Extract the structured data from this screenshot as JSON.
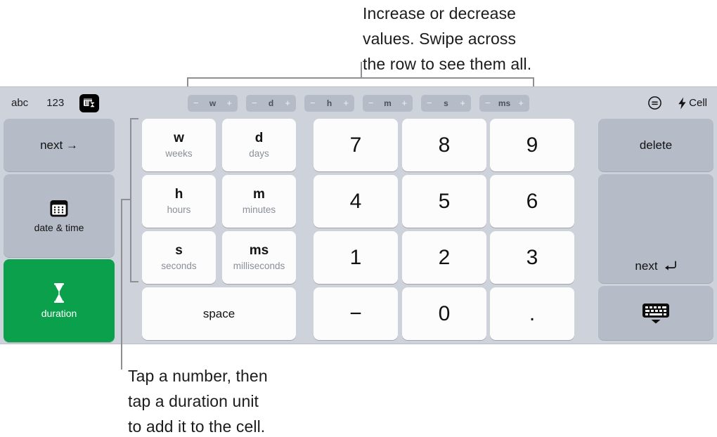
{
  "annotations": {
    "top_callout": "Increase or decrease\nvalues. Swipe across\nthe row to see them all.",
    "bottom_callout": "Tap a number, then\ntap a duration unit\nto add it to the cell."
  },
  "keyboard": {
    "toolbar": {
      "modes": [
        {
          "label": "abc",
          "name": "abc"
        },
        {
          "label": "123",
          "name": "123"
        }
      ],
      "mode_icon_name": "table-duration-icon",
      "steppers": [
        {
          "unit": "w",
          "minus": "−",
          "plus": "+"
        },
        {
          "unit": "d",
          "minus": "−",
          "plus": "+"
        },
        {
          "unit": "h",
          "minus": "−",
          "plus": "+"
        },
        {
          "unit": "m",
          "minus": "−",
          "plus": "+"
        },
        {
          "unit": "s",
          "minus": "−",
          "plus": "+"
        },
        {
          "unit": "ms",
          "minus": "−",
          "plus": "+"
        }
      ],
      "formula_icon_name": "equals-circle-icon",
      "cell_label": "Cell",
      "cell_icon_name": "bolt-icon"
    },
    "left_keys": [
      {
        "label": "next →",
        "name": "next-field-key",
        "style": "gray"
      },
      {
        "label": "date & time",
        "name": "date-time-key",
        "icon": "calendar-icon",
        "style": "gray"
      },
      {
        "label": "duration",
        "name": "duration-key",
        "icon": "hourglass-icon",
        "style": "green"
      }
    ],
    "unit_keys": [
      {
        "abbr": "w",
        "full": "weeks"
      },
      {
        "abbr": "d",
        "full": "days"
      },
      {
        "abbr": "h",
        "full": "hours"
      },
      {
        "abbr": "m",
        "full": "minutes"
      },
      {
        "abbr": "s",
        "full": "seconds"
      },
      {
        "abbr": "ms",
        "full": "milliseconds"
      }
    ],
    "space_key": "space",
    "number_keys": [
      "7",
      "8",
      "9",
      "4",
      "5",
      "6",
      "1",
      "2",
      "3",
      "−",
      "0",
      "."
    ],
    "right_keys": {
      "delete": "delete",
      "next": "next",
      "next_glyph": "↩",
      "dismiss_icon_name": "hide-keyboard-icon"
    }
  },
  "colors": {
    "panel_bg": "#ced3db",
    "key_light": "#fcfcfd",
    "key_gray": "#b6bcc7",
    "accent_green": "#0aa04c",
    "leader_line": "#8e8e93"
  }
}
